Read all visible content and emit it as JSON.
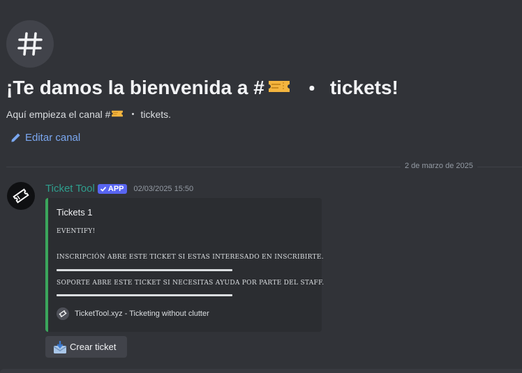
{
  "channel": {
    "welcome_title_prefix": "¡Te damos la bienvenida a #",
    "name": "tickets!",
    "subtitle_prefix": "Aquí empieza el canal #",
    "subtitle_name": "tickets.",
    "edit_label": "Editar canal",
    "separator": "・"
  },
  "divider": {
    "date": "2 de marzo de 2025"
  },
  "message": {
    "author": "Ticket Tool",
    "badge": "APP",
    "timestamp": "02/03/2025 15:50",
    "author_color": "#2f9e8d",
    "embed": {
      "title": "Tickets 1",
      "line1": "EVENTIFY!",
      "line2": "INSCRIPCIÓN ABRE ESTE TICKET SI ESTAS INTERESADO EN INSCRIBIRTE.",
      "line3": "SOPORTE ABRE ESTE TICKET SI NECESITAS AYUDA POR PARTE DEL STAFF.",
      "footer": "TicketTool.xyz - Ticketing without clutter",
      "accent_color": "#3ba55c"
    },
    "button": {
      "label": "Crear ticket",
      "icon": "envelope-download-icon"
    }
  },
  "icons": {
    "channel": "hash-icon",
    "ticket": "ticket-emoji-icon",
    "edit": "pencil-icon",
    "avatar": "ticket-tool-logo-icon",
    "verified": "check-icon"
  },
  "colors": {
    "background": "#313338",
    "link": "#7aa7f0",
    "badge": "#5865f2"
  }
}
